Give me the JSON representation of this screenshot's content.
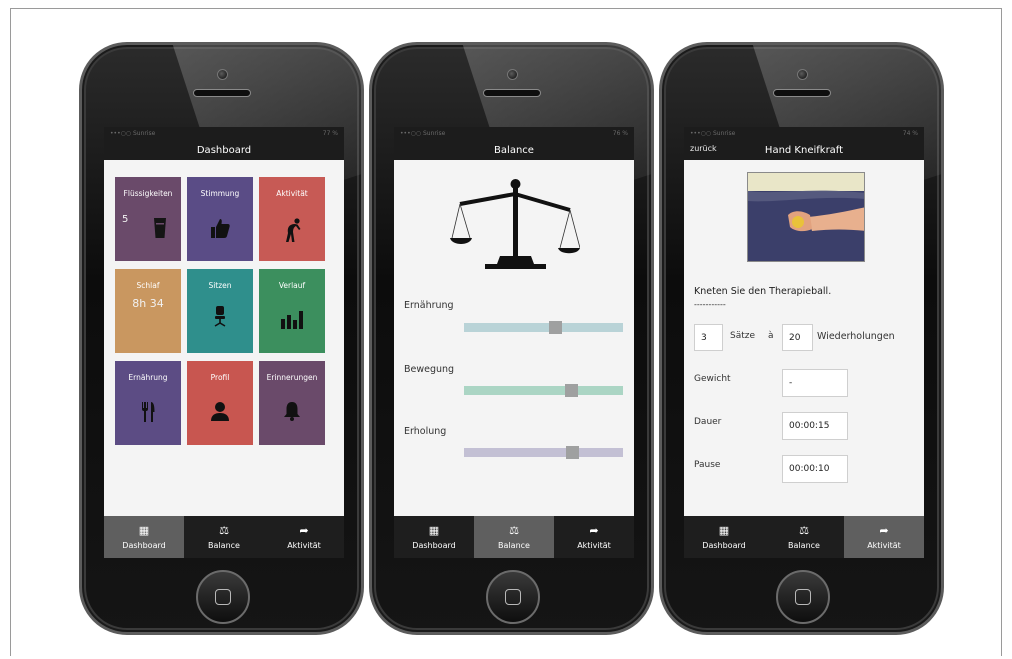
{
  "phone1": {
    "status_carrier": "•••○○ Sunrise",
    "status_right": "77 %",
    "title": "Dashboard",
    "tiles": [
      {
        "label": "Flüssigkeiten",
        "value": "5",
        "icon": "glass-icon",
        "color": "#6a4a6a"
      },
      {
        "label": "Stimmung",
        "icon": "thumbs-up-icon",
        "color": "#5a4c86"
      },
      {
        "label": "Aktivität",
        "icon": "stretching-person-icon",
        "color": "#c75a55"
      },
      {
        "label": "Schlaf",
        "value": "8h 34",
        "color": "#c99760"
      },
      {
        "label": "Sitzen",
        "icon": "office-chair-icon",
        "color": "#2f8f8c"
      },
      {
        "label": "Verlauf",
        "icon": "bar-chart-icon",
        "color": "#3c8f5e"
      },
      {
        "label": "Ernährung",
        "icon": "fork-knife-icon",
        "color": "#5c4c84"
      },
      {
        "label": "Profil",
        "icon": "person-icon",
        "color": "#c85650"
      },
      {
        "label": "Erinnerungen",
        "icon": "bell-icon",
        "color": "#6a4a6a"
      }
    ]
  },
  "phone2": {
    "status_carrier": "•••○○ Sunrise",
    "status_right": "76 %",
    "title": "Balance",
    "sections": [
      {
        "label": "Ernährung",
        "value": 0.58,
        "track_color": "#b9d3d7"
      },
      {
        "label": "Bewegung",
        "value": 0.69,
        "track_color": "#abd5c4"
      },
      {
        "label": "Erholung",
        "value": 0.7,
        "track_color": "#c3c0d4"
      }
    ]
  },
  "phone3": {
    "status_carrier": "•••○○ Sunrise",
    "status_right": "74 %",
    "back": "zurück",
    "title": "Hand Kneifkraft",
    "instruction": "Kneten Sie den Therapieball.",
    "dashes": "-----------",
    "sets_value": "3",
    "sets_label": "Sätze",
    "a_label": "à",
    "reps_value": "20",
    "reps_label": "Wiederholungen",
    "rows": [
      {
        "label": "Gewicht",
        "value": "-"
      },
      {
        "label": "Dauer",
        "value": "00:00:15"
      },
      {
        "label": "Pause",
        "value": "00:00:10"
      }
    ]
  },
  "tabs": [
    {
      "label": "Dashboard",
      "icon": "grid-icon"
    },
    {
      "label": "Balance",
      "icon": "scale-icon"
    },
    {
      "label": "Aktivität",
      "icon": "running-person-icon"
    }
  ]
}
